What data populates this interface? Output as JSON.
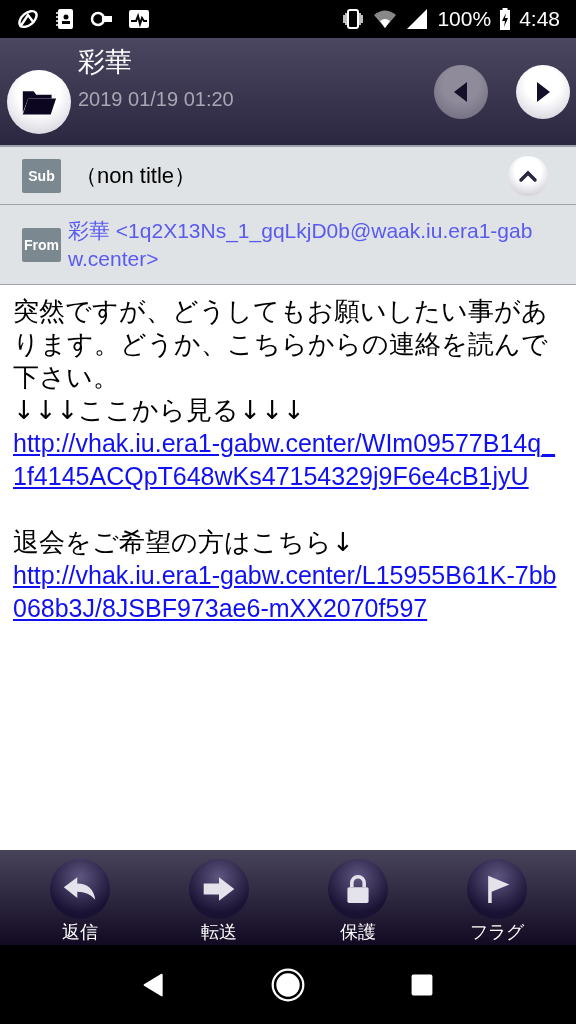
{
  "status_bar": {
    "battery": "100%",
    "time": "4:48"
  },
  "header": {
    "sender": "彩華",
    "date": "2019 01/19 01:20"
  },
  "subject": {
    "badge": "Sub",
    "text": "（non title）",
    "expanded": true
  },
  "from": {
    "badge": "From",
    "text": "彩華 <1q2X13Ns_1_gqLkjD0b@waak.iu.era1-gabw.center>"
  },
  "body": [
    {
      "lines": [
        {
          "kind": "text",
          "text": "突然ですが、どうしてもお願いしたい事があります。どうか、こちらからの連絡を読んで下さい。"
        },
        {
          "kind": "text",
          "text": "↓↓↓ここから見る↓↓↓"
        },
        {
          "kind": "link",
          "text": "http://vhak.iu.era1-gabw.center/WIm09577B14q_1f4145ACQpT648wKs47154329j9F6e4cB1jyU"
        }
      ]
    },
    {
      "lines": [
        {
          "kind": "text",
          "text": "退会をご希望の方はこちら↓"
        },
        {
          "kind": "link",
          "text": "http://vhak.iu.era1-gabw.center/L15955B61K-7bb068b3J/8JSBF973ae6-mXX2070f597"
        }
      ]
    }
  ],
  "toolbar": [
    {
      "kind": "reply",
      "label": "返信"
    },
    {
      "kind": "forward",
      "label": "転送"
    },
    {
      "kind": "lock",
      "label": "保護"
    },
    {
      "kind": "flag",
      "label": "フラグ"
    }
  ]
}
